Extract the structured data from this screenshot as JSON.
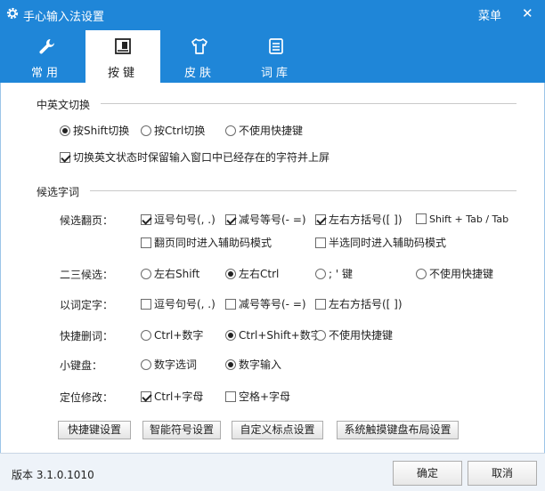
{
  "window": {
    "title": "手心输入法设置",
    "menu_label": "菜单",
    "close_label": "✕"
  },
  "tabs": [
    {
      "label": "常用",
      "icon": "wrench-icon",
      "active": false
    },
    {
      "label": "按键",
      "icon": "keyboard-icon",
      "active": true
    },
    {
      "label": "皮肤",
      "icon": "tshirt-icon",
      "active": false
    },
    {
      "label": "词库",
      "icon": "dictionary-icon",
      "active": false
    }
  ],
  "switch_group": {
    "title": "中英文切换",
    "radios": [
      {
        "label": "按Shift切换",
        "checked": true
      },
      {
        "label": "按Ctrl切换",
        "checked": false
      },
      {
        "label": "不使用快捷键",
        "checked": false
      }
    ],
    "keep_input_checkbox": {
      "label": "切换英文状态时保留输入窗口中已经存在的字符并上屏",
      "checked": true
    }
  },
  "candidate_group": {
    "title": "候选字词",
    "paging": {
      "label": "候选翻页：",
      "options": [
        {
          "label": "逗号句号(, .)",
          "checked": true
        },
        {
          "label": "减号等号(- =)",
          "checked": true
        },
        {
          "label": "左右方括号([ ])",
          "checked": true
        },
        {
          "label": "Shift + Tab / Tab",
          "checked": false
        },
        {
          "label": "翻页同时进入辅助码模式",
          "checked": false
        },
        {
          "label": "半选同时进入辅助码模式",
          "checked": false
        }
      ]
    },
    "second_third": {
      "label": "二三候选：",
      "options": [
        {
          "label": "左右Shift",
          "checked": false
        },
        {
          "label": "左右Ctrl",
          "checked": true
        },
        {
          "label": "; ' 键",
          "checked": false
        },
        {
          "label": "不使用快捷键",
          "checked": false
        }
      ]
    },
    "word_select": {
      "label": "以词定字：",
      "options": [
        {
          "label": "逗号句号(, .)",
          "checked": false
        },
        {
          "label": "减号等号(- =)",
          "checked": false
        },
        {
          "label": "左右方括号([ ])",
          "checked": false
        }
      ]
    },
    "quick_delete": {
      "label": "快捷删词：",
      "options": [
        {
          "label": "Ctrl+数字",
          "checked": false
        },
        {
          "label": "Ctrl+Shift+数字",
          "checked": true
        },
        {
          "label": "不使用快捷键",
          "checked": false
        }
      ]
    },
    "keypad": {
      "label": "小键盘：",
      "options": [
        {
          "label": "数字选词",
          "checked": false
        },
        {
          "label": "数字输入",
          "checked": true
        }
      ]
    },
    "locate_edit": {
      "label": "定位修改：",
      "options": [
        {
          "label": "Ctrl+字母",
          "checked": true
        },
        {
          "label": "空格+字母",
          "checked": false
        }
      ]
    }
  },
  "action_buttons": [
    {
      "label": "快捷键设置"
    },
    {
      "label": "智能符号设置"
    },
    {
      "label": "自定义标点设置"
    },
    {
      "label": "系统触摸键盘布局设置"
    }
  ],
  "footer": {
    "version": "版本 3.1.0.1010",
    "ok_label": "确定",
    "cancel_label": "取消"
  },
  "colors": {
    "titlebar": "#1f86d8",
    "footer": "#eef3f9"
  }
}
